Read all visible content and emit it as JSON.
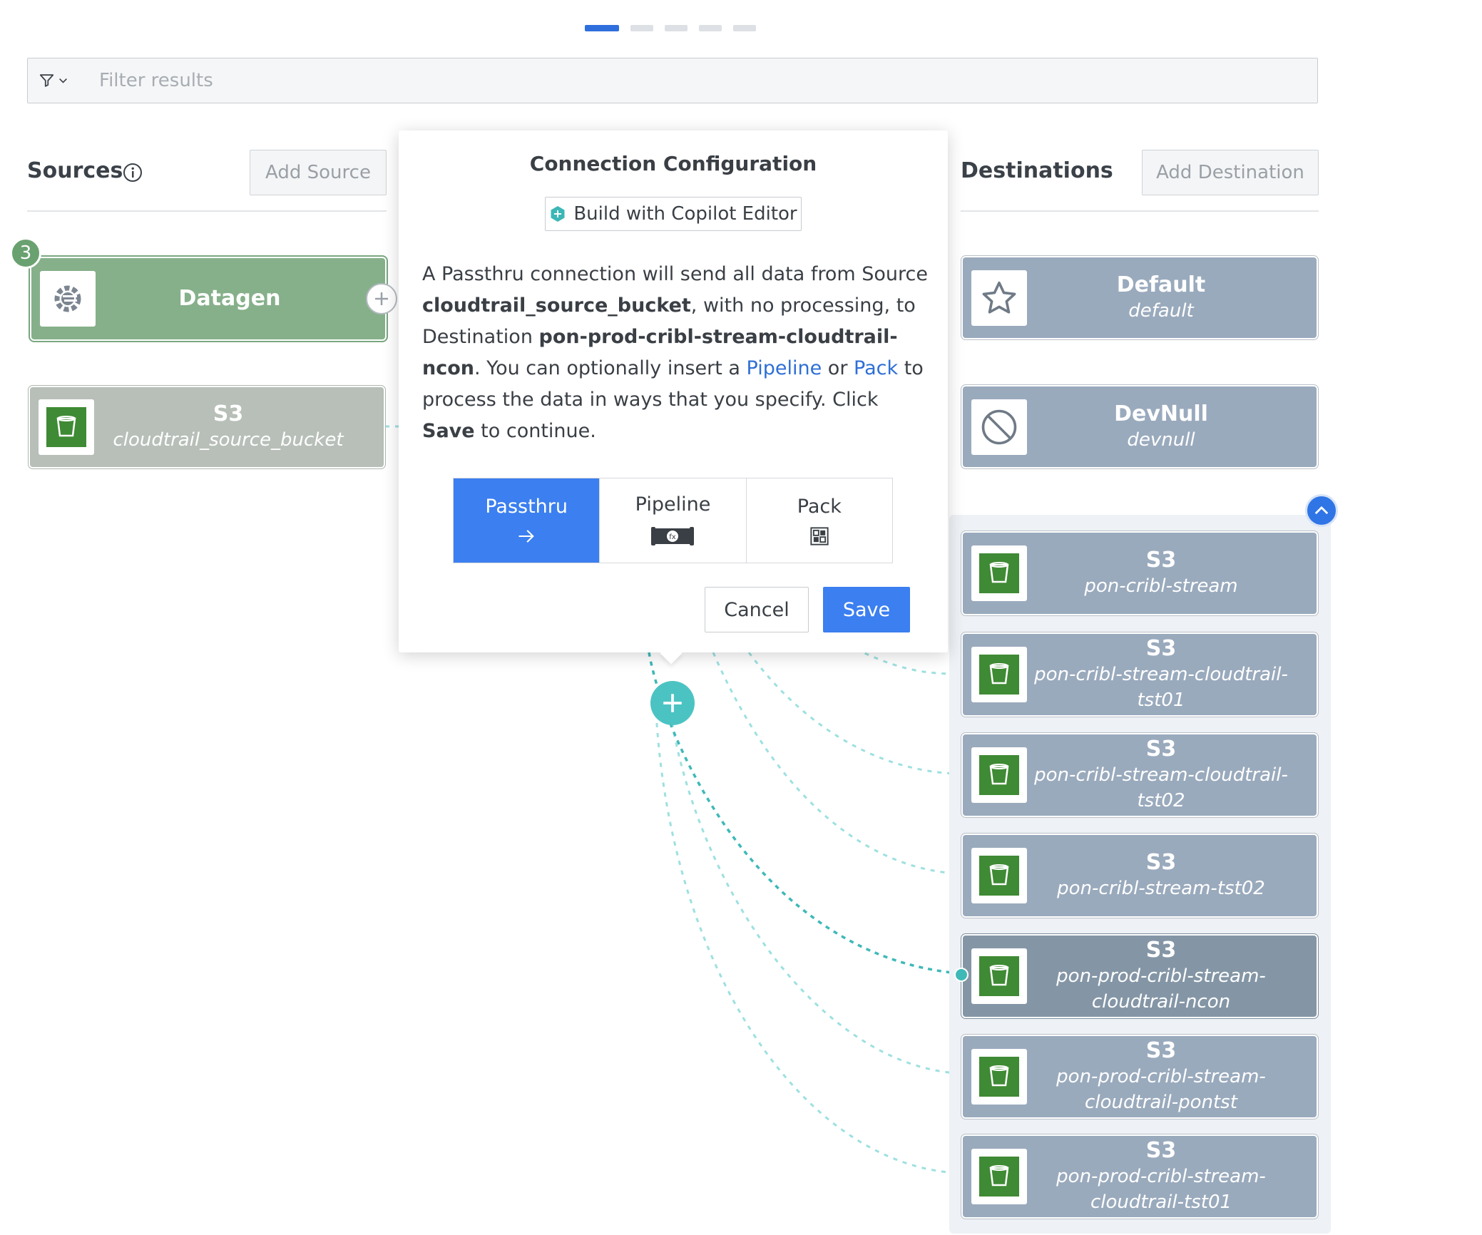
{
  "filter": {
    "placeholder": "Filter results"
  },
  "sources": {
    "title": "Sources",
    "add_label": "Add Source",
    "badge": "3",
    "items": [
      {
        "type": "Datagen",
        "name": ""
      },
      {
        "type": "S3",
        "name": "cloudtrail_source_bucket"
      }
    ]
  },
  "destinations": {
    "title": "Destinations",
    "add_label": "Add Destination",
    "items": [
      {
        "type": "Default",
        "name": "default"
      },
      {
        "type": "DevNull",
        "name": "devnull"
      },
      {
        "type": "S3",
        "name": "pon-cribl-stream"
      },
      {
        "type": "S3",
        "name": "pon-cribl-stream-cloudtrail-tst01"
      },
      {
        "type": "S3",
        "name": "pon-cribl-stream-cloudtrail-tst02"
      },
      {
        "type": "S3",
        "name": "pon-cribl-stream-tst02"
      },
      {
        "type": "S3",
        "name": "pon-prod-cribl-stream-cloudtrail-ncon"
      },
      {
        "type": "S3",
        "name": "pon-prod-cribl-stream-cloudtrail-pontst"
      },
      {
        "type": "S3",
        "name": "pon-prod-cribl-stream-cloudtrail-tst01"
      }
    ]
  },
  "modal": {
    "title": "Connection Configuration",
    "copilot_label": "Build with Copilot Editor",
    "desc": {
      "p1": "A Passthru connection will send all data from Source ",
      "source": "cloudtrail_source_bucket",
      "p2": ", with no processing, to Destination ",
      "destination": "pon-prod-cribl-stream-cloudtrail-ncon",
      "p3": ". You can optionally insert a ",
      "pipeline_link": "Pipeline",
      "p4": " or ",
      "pack_link": "Pack",
      "p5": " to process the data in ways that you specify. Click ",
      "save_word": "Save",
      "p6": " to continue."
    },
    "options": [
      "Passthru",
      "Pipeline",
      "Pack"
    ],
    "cancel_label": "Cancel",
    "save_label": "Save"
  },
  "colors": {
    "accent": "#3b7ff0",
    "source_green": "#86b08a",
    "destination_blue": "#9aaabd",
    "connector_teal": "#5cc8c8"
  }
}
